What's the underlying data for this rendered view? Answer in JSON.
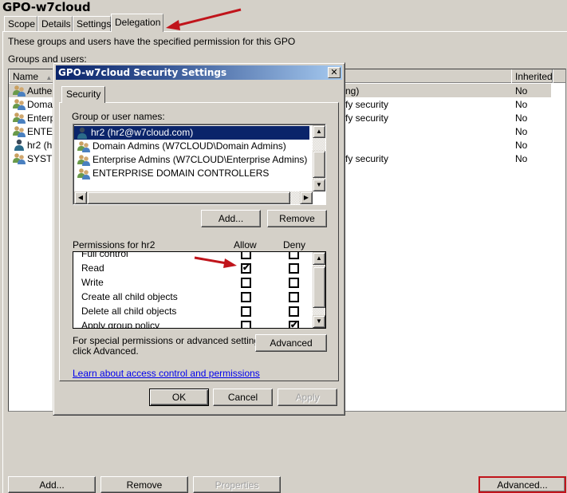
{
  "window": {
    "title": "GPO-w7cloud"
  },
  "tabs": [
    {
      "label": "Scope",
      "active": false
    },
    {
      "label": "Details",
      "active": false
    },
    {
      "label": "Settings",
      "active": false
    },
    {
      "label": "Delegation",
      "active": true
    }
  ],
  "delegation": {
    "description": "These groups and users have the specified permission for this GPO",
    "groups_label": "Groups and users:",
    "columns": {
      "name": "Name",
      "inherited": "Inherited"
    },
    "rows": [
      {
        "name": "Authenticated Users",
        "name_visible": "Authen",
        "permission_visible": "ng)",
        "inherited": "No",
        "icon": "group-icon",
        "selected": true
      },
      {
        "name": "Domain Admins",
        "name_visible": "Domair",
        "permission_visible": "fy security",
        "inherited": "No",
        "icon": "group-icon",
        "selected": false
      },
      {
        "name": "Enterprise Admins",
        "name_visible": "Enterpr",
        "permission_visible": "fy security",
        "inherited": "No",
        "icon": "group-icon",
        "selected": false
      },
      {
        "name": "ENTERPRISE DOMAIN CONTROLLERS",
        "name_visible": "ENTER",
        "permission_visible": "",
        "inherited": "No",
        "icon": "group-icon",
        "selected": false
      },
      {
        "name": "hr2",
        "name_visible": "hr2 (hr2",
        "permission_visible": "",
        "inherited": "No",
        "icon": "user-icon",
        "selected": false
      },
      {
        "name": "SYSTEM",
        "name_visible": "SYSTE",
        "permission_visible": "fy security",
        "inherited": "No",
        "icon": "group-icon",
        "selected": false
      }
    ],
    "buttons": {
      "add": "Add...",
      "remove": "Remove",
      "properties": "Properties",
      "advanced": "Advanced..."
    }
  },
  "dialog": {
    "title": "GPO-w7cloud Security Settings",
    "close_glyph": "✕",
    "tab": "Security",
    "group_label": "Group or user names:",
    "principals": [
      {
        "label": "hr2 (hr2@w7cloud.com)",
        "icon": "user-icon",
        "selected": true
      },
      {
        "label": "Domain Admins (W7CLOUD\\Domain Admins)",
        "icon": "group-icon",
        "selected": false
      },
      {
        "label": "Enterprise Admins (W7CLOUD\\Enterprise Admins)",
        "icon": "group-icon",
        "selected": false
      },
      {
        "label": "ENTERPRISE DOMAIN CONTROLLERS",
        "icon": "group-icon",
        "selected": false
      }
    ],
    "add_button": "Add...",
    "remove_button": "Remove",
    "permissions_label": "Permissions for hr2",
    "allow_label": "Allow",
    "deny_label": "Deny",
    "permissions": [
      {
        "name": "Full control",
        "allow": false,
        "deny": false
      },
      {
        "name": "Read",
        "allow": true,
        "deny": false
      },
      {
        "name": "Write",
        "allow": false,
        "deny": false
      },
      {
        "name": "Create all child objects",
        "allow": false,
        "deny": false
      },
      {
        "name": "Delete all child objects",
        "allow": false,
        "deny": false
      },
      {
        "name": "Apply group policy",
        "allow": false,
        "deny": true
      }
    ],
    "advanced_text_line1": "For special permissions or advanced settings,",
    "advanced_text_line2": "click Advanced.",
    "advanced_button": "Advanced",
    "learn_link": "Learn about access control and permissions",
    "ok_button": "OK",
    "cancel_button": "Cancel",
    "apply_button": "Apply",
    "check_glyph": "✔"
  },
  "annotations": {
    "arrow_color": "#c0141b",
    "highlight_color": "#c0141b"
  }
}
